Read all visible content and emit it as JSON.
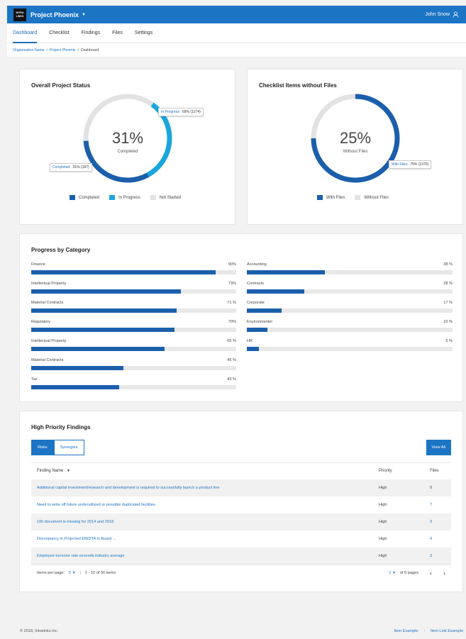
{
  "header": {
    "logo_line1": "INTRA",
    "logo_line2": "LINKS",
    "app_title": "Project Phoenix",
    "user_name": "John Snow"
  },
  "nav": {
    "tabs": [
      {
        "label": "Dashboard",
        "active": true
      },
      {
        "label": "Checklist"
      },
      {
        "label": "Findings"
      },
      {
        "label": "Files"
      },
      {
        "label": "Settings"
      }
    ]
  },
  "breadcrumb": {
    "org": "Organisation Name",
    "project": "Project Phoenix",
    "current": "Dashboard",
    "separator": "/"
  },
  "overall_status": {
    "title": "Overall Project Status",
    "center_pct": "31%",
    "center_label": "Completed",
    "tip_in_progress_label": "In Progress:",
    "tip_in_progress_value": "69% (1274)",
    "tip_completed_label": "Completed:",
    "tip_completed_value": "31% (187)",
    "legend": [
      "Completed",
      "In Progress",
      "Not Started"
    ],
    "colors": {
      "completed": "#1b5fab",
      "in_progress": "#1aa6dc",
      "not_started": "#e2e2e2"
    }
  },
  "checklist_files": {
    "title": "Checklist Items without Files",
    "center_pct": "25%",
    "center_label": "Without Files",
    "tip_label": "With Files:",
    "tip_value": "75% (1370)",
    "legend": [
      "With Files",
      "Without Files"
    ],
    "colors": {
      "with_files": "#1b5fab",
      "without_files": "#e2e2e2"
    }
  },
  "progress": {
    "title": "Progress by Category",
    "left": [
      {
        "label": "Finance",
        "pct_text": "90%",
        "value": 90
      },
      {
        "label": "Intellectual Property",
        "pct_text": "73%",
        "value": 73
      },
      {
        "label": "Material Contracts",
        "pct_text": "71 %",
        "value": 71
      },
      {
        "label": "Regulatory",
        "pct_text": "70%",
        "value": 70
      },
      {
        "label": "Intellectual Property",
        "pct_text": "65 %",
        "value": 65
      },
      {
        "label": "Material Contracts",
        "pct_text": "45 %",
        "value": 45
      },
      {
        "label": "Tax",
        "pct_text": "43 %",
        "value": 43
      }
    ],
    "right": [
      {
        "label": "Accounting",
        "pct_text": "38 %",
        "value": 38
      },
      {
        "label": "Contracts",
        "pct_text": "28 %",
        "value": 28
      },
      {
        "label": "Corporate",
        "pct_text": "17 %",
        "value": 17
      },
      {
        "label": "Environmentel",
        "pct_text": "10 %",
        "value": 10
      },
      {
        "label": "HR",
        "pct_text": "6 %",
        "value": 6
      }
    ]
  },
  "findings": {
    "title": "High Priority Findings",
    "seg_risks": "Risks",
    "seg_synergies": "Synergies",
    "view_all": "View All",
    "col_name": "Finding Name",
    "col_priority": "Priority",
    "col_files": "Files",
    "rows": [
      {
        "name": "Additional capital investment/research and development is required to successfully launch a product line",
        "priority": "High",
        "files": "0"
      },
      {
        "name": "Need to write off future underutilized or possible duplicated facilities",
        "priority": "High",
        "files": "7"
      },
      {
        "name": "10k document is missing for 2014 and 2018",
        "priority": "High",
        "files": "3"
      },
      {
        "name": "Discrepancy in Projected EBIDTA in Board ...",
        "priority": "High",
        "files": "4"
      },
      {
        "name": "Employee turnover rate exceeds industry average",
        "priority": "High",
        "files": "3"
      }
    ],
    "pager": {
      "items_label": "Items per page:",
      "per_page": "5",
      "range": "1 - 10 of 56 items",
      "page": "1",
      "of_pages": "of 6 pages"
    }
  },
  "footer": {
    "copyright": "© 2018, Intralinks Inc.",
    "link1": "Item Example",
    "link2": "Item Link Example"
  }
}
